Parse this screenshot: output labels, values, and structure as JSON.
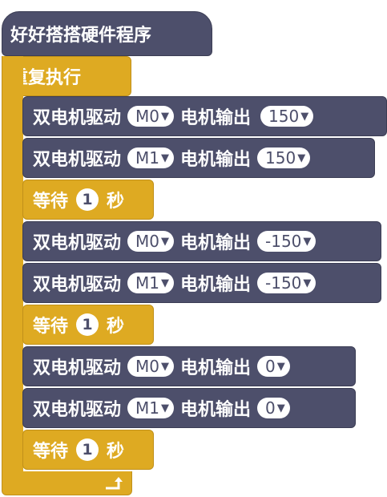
{
  "hat": {
    "label": "好好搭搭硬件程序"
  },
  "loop": {
    "label": "重复执行"
  },
  "blocks": [
    {
      "type": "motor",
      "label": "双电机驱动",
      "motor": "M0",
      "output_label": "电机输出",
      "value": "150"
    },
    {
      "type": "motor",
      "label": "双电机驱动",
      "motor": "M1",
      "output_label": "电机输出",
      "value": "150"
    },
    {
      "type": "wait",
      "label": "等待",
      "seconds": "1",
      "unit": "秒"
    },
    {
      "type": "motor",
      "label": "双电机驱动",
      "motor": "M0",
      "output_label": "电机输出",
      "value": "-150"
    },
    {
      "type": "motor",
      "label": "双电机驱动",
      "motor": "M1",
      "output_label": "电机输出",
      "value": "-150"
    },
    {
      "type": "wait",
      "label": "等待",
      "seconds": "1",
      "unit": "秒"
    },
    {
      "type": "motor",
      "label": "双电机驱动",
      "motor": "M0",
      "output_label": "电机输出",
      "value": "0"
    },
    {
      "type": "motor",
      "label": "双电机驱动",
      "motor": "M1",
      "output_label": "电机输出",
      "value": "0"
    },
    {
      "type": "wait",
      "label": "等待",
      "seconds": "1",
      "unit": "秒"
    }
  ],
  "colors": {
    "motor_block": "#4d4f6b",
    "control_block": "#deaa22",
    "field": "#ffffff"
  },
  "icons": {
    "dropdown": "caret-down-icon",
    "loop_end": "loop-arrow-icon"
  }
}
